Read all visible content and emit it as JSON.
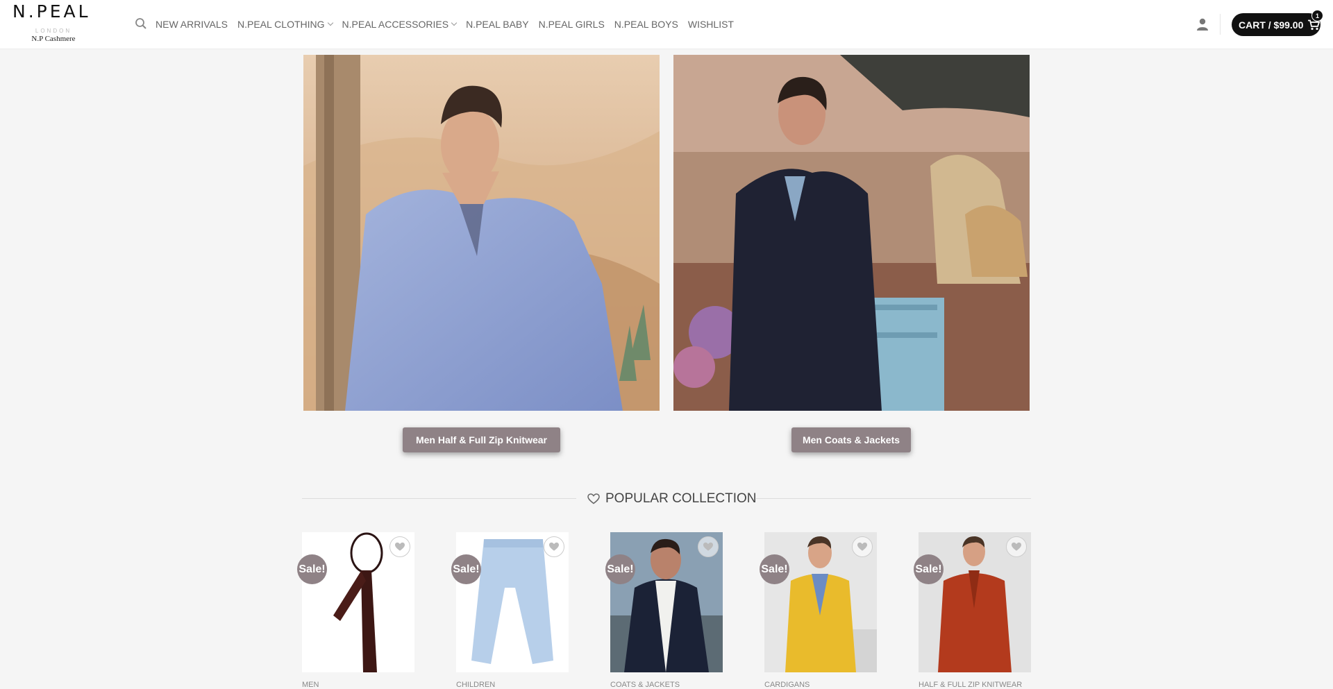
{
  "header": {
    "logo_main": "N.PEAL",
    "logo_sub": "LONDON",
    "logo_tag": "N.P Cashmere",
    "nav": [
      {
        "label": "NEW ARRIVALS"
      },
      {
        "label": "N.PEAL CLOTHING"
      },
      {
        "label": "N.PEAL ACCESSORIES"
      },
      {
        "label": "N.PEAL BABY"
      },
      {
        "label": "N.PEAL GIRLS"
      },
      {
        "label": "N.PEAL BOYS"
      },
      {
        "label": "WISHLIST"
      }
    ],
    "cart_label": "CART / $99.00",
    "cart_count": "1"
  },
  "banners": {
    "left_button": "Men Half & Full Zip Knitwear",
    "right_button": "Men Coats & Jackets"
  },
  "section": {
    "title": "POPULAR COLLECTION"
  },
  "products": [
    {
      "category": "MEN",
      "badge": "Sale!"
    },
    {
      "category": "CHILDREN",
      "badge": "Sale!"
    },
    {
      "category": "COATS & JACKETS",
      "badge": "Sale!"
    },
    {
      "category": "CARDIGANS",
      "badge": "Sale!"
    },
    {
      "category": "HALF & FULL ZIP KNITWEAR",
      "badge": "Sale!"
    }
  ],
  "colors": {
    "accent": "#8f8286",
    "cart_bg": "#111111",
    "page_bg": "#f5f5f5"
  },
  "icons": [
    "search-icon",
    "chevron-down-icon",
    "user-icon",
    "cart-icon",
    "heart-icon"
  ]
}
